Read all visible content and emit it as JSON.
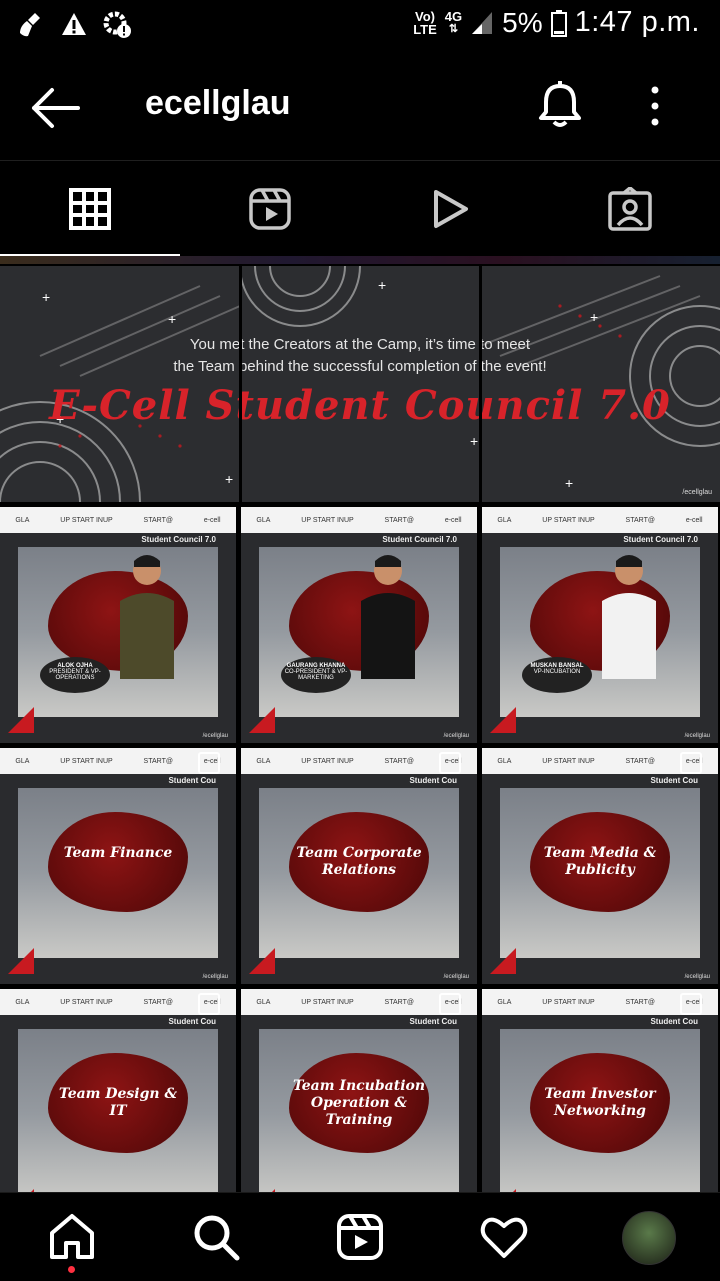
{
  "status": {
    "network": "Vo) LTE",
    "net_top": "Vo)",
    "net_bottom": "LTE",
    "signal": "4G",
    "battery": "5%",
    "time": "1:47 p.m."
  },
  "header": {
    "username": "ecellglau",
    "back_icon": "back-arrow-icon",
    "bell_icon": "bell-icon",
    "more_icon": "more-vertical-icon"
  },
  "tabs": [
    {
      "id": "posts",
      "icon": "grid-icon",
      "active": true
    },
    {
      "id": "reels",
      "icon": "reels-icon",
      "active": false
    },
    {
      "id": "videos",
      "icon": "play-icon",
      "active": false
    },
    {
      "id": "tagged",
      "icon": "tagged-icon",
      "active": false
    }
  ],
  "banner": {
    "line1": "You met the Creators at the Camp, it’s time to meet",
    "line2": "the Team behind the successful completion of the event!",
    "title": "E-Cell Student Council 7.0",
    "handle": "/ecellglau"
  },
  "posts": [
    {
      "type": "person",
      "council": "Student Council 7.0",
      "name": "ALOK OJHA",
      "role": "PRESIDENT & VP-OPERATIONS"
    },
    {
      "type": "person",
      "council": "Student Council 7.0",
      "name": "GAURANG KHANNA",
      "role": "CO-PRESIDENT & VP-MARKETING"
    },
    {
      "type": "person",
      "council": "Student Council 7.0",
      "name": "MUSKAN BANSAL",
      "role": "VP-INCUBATION"
    },
    {
      "type": "team",
      "council": "Student Cou",
      "title": "Team Finance"
    },
    {
      "type": "team",
      "council": "Student Cou",
      "title": "Team Corporate Relations"
    },
    {
      "type": "team",
      "council": "Student Cou",
      "title": "Team Media & Publicity"
    },
    {
      "type": "team",
      "council": "Student Cou",
      "title": "Team Design & IT"
    },
    {
      "type": "team",
      "council": "Student Cou",
      "title": "Team Incubation Operation & Training"
    },
    {
      "type": "team",
      "council": "Student Cou",
      "title": "Team Investor Networking"
    }
  ],
  "logos": {
    "gla": "GLA",
    "start": "UP START INUP",
    "startin": "START@",
    "ecell": "e-cell"
  },
  "colors": {
    "accent_red": "#d8232a",
    "background": "#000000",
    "notification_dot": "#ff3040"
  },
  "bottom_nav": [
    {
      "id": "home",
      "icon": "home-icon"
    },
    {
      "id": "search",
      "icon": "search-icon"
    },
    {
      "id": "reels",
      "icon": "reels-icon"
    },
    {
      "id": "activity",
      "icon": "heart-icon"
    },
    {
      "id": "profile",
      "icon": "avatar"
    }
  ]
}
